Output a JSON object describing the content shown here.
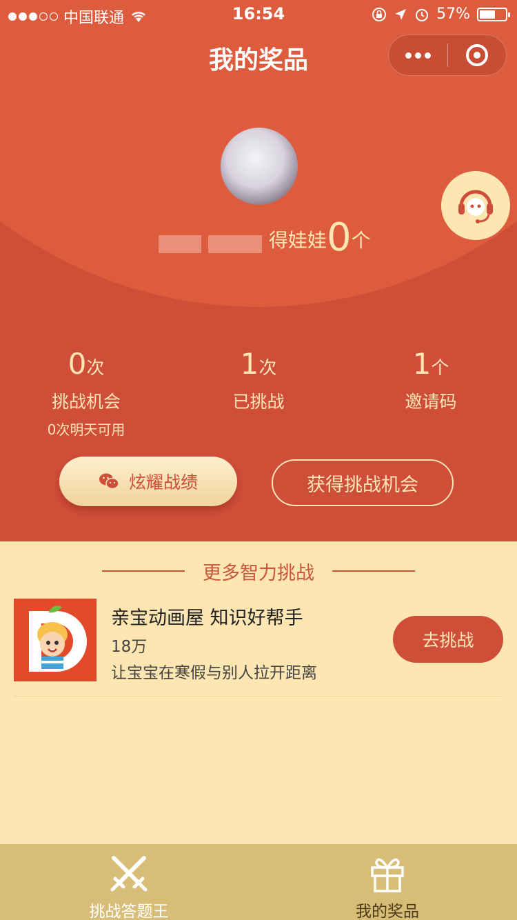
{
  "status_bar": {
    "carrier": "中国联通",
    "time": "16:54",
    "battery": "57%"
  },
  "nav": {
    "title": "我的奖品"
  },
  "profile": {
    "label": "得娃娃",
    "count": "0",
    "unit": "个"
  },
  "stats": [
    {
      "value": "0",
      "unit": "次",
      "label": "挑战机会",
      "sub": "0次明天可用"
    },
    {
      "value": "1",
      "unit": "次",
      "label": "已挑战"
    },
    {
      "value": "1",
      "unit": "个",
      "label": "邀请码"
    }
  ],
  "buttons": {
    "show_off": "炫耀战绩",
    "get_chance": "获得挑战机会"
  },
  "section": {
    "title": "更多智力挑战"
  },
  "items": [
    {
      "title": "亲宝动画屋 知识好帮手",
      "count": "18万",
      "desc": "让宝宝在寒假与别人拉开距离",
      "action": "去挑战"
    }
  ],
  "tabs": [
    {
      "label": "挑战答题王",
      "icon": "crossed-swords-icon"
    },
    {
      "label": "我的奖品",
      "icon": "gift-icon"
    }
  ],
  "colors": {
    "primary_red": "#cf4e38",
    "arc_red": "#dd5c3e",
    "cream": "#fde6b1",
    "tabbar": "#d8bd77"
  }
}
